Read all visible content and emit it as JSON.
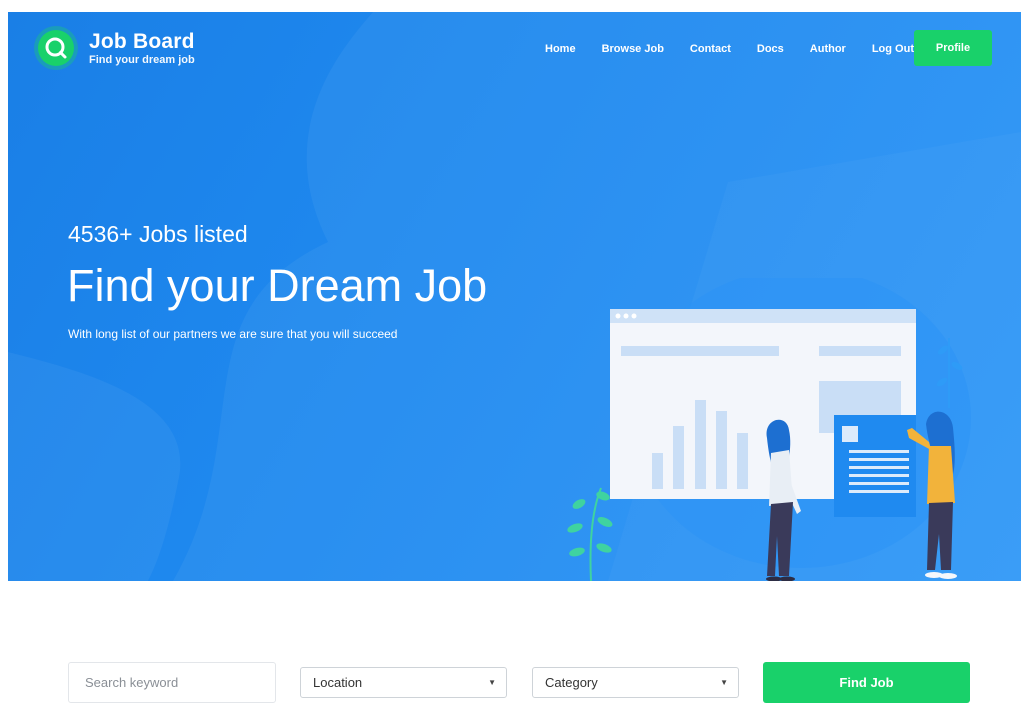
{
  "brand": {
    "title": "Job Board",
    "tagline": "Find your dream job",
    "icon": "search-icon"
  },
  "nav": {
    "items": [
      "Home",
      "Browse Job",
      "Contact",
      "Docs",
      "Author",
      "Log Out"
    ],
    "profile_label": "Profile"
  },
  "hero": {
    "count_text": "4536+ Jobs listed",
    "headline": "Find your Dream Job",
    "subtext": "With long list of our partners we are sure that you will succeed"
  },
  "search": {
    "keyword_placeholder": "Search keyword",
    "location_value": "Location",
    "category_value": "Category",
    "submit_label": "Find Job"
  },
  "colors": {
    "hero_blue": "#1f8af0",
    "accent_green": "#19d16a",
    "text_white": "#ffffff"
  }
}
